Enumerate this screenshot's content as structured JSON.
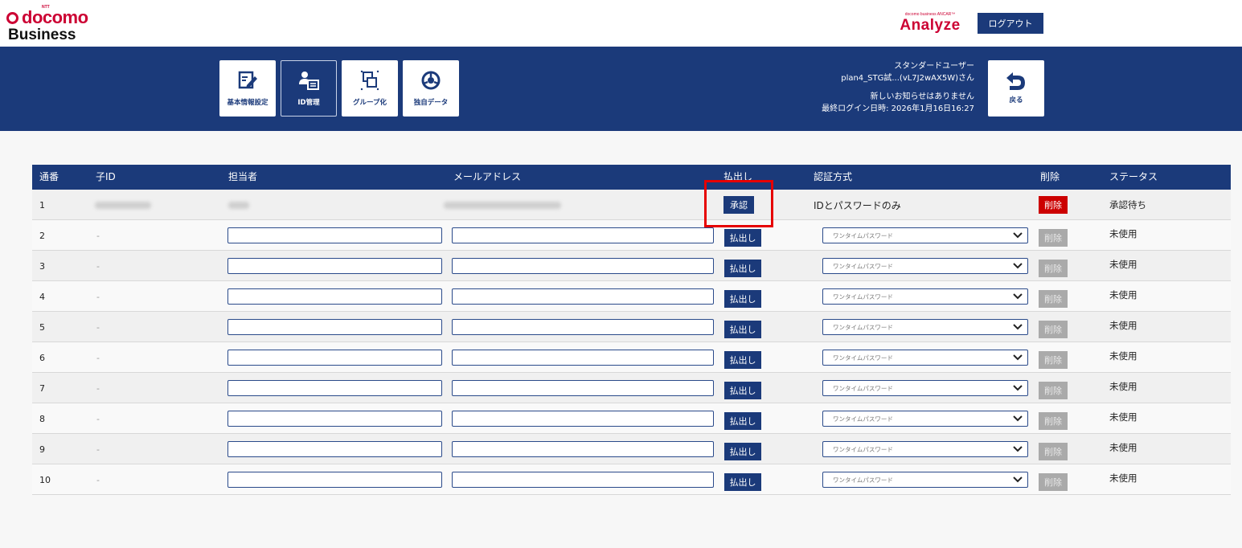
{
  "header": {
    "logo": {
      "ntt": "NTT",
      "brand": "docomo",
      "business": "Business"
    },
    "analyze": {
      "small": "docomo business ANCAR™",
      "big": "Analyze"
    },
    "logout_label": "ログアウト"
  },
  "nav": [
    {
      "label": "基本情報設定",
      "icon": "edit-icon"
    },
    {
      "label": "ID管理",
      "icon": "id-card-icon"
    },
    {
      "label": "グループ化",
      "icon": "group-icon"
    },
    {
      "label": "独自データ",
      "icon": "data-icon"
    }
  ],
  "user": {
    "role": "スタンダードユーザー",
    "name": "plan4_STG試...(vL7J2wAX5W)さん",
    "notice": "新しいお知らせはありません",
    "last_login": "最終ログイン日時: 2026年1月16日16:27"
  },
  "back_label": "戻る",
  "table": {
    "headers": {
      "no": "通番",
      "child_id": "子ID",
      "person": "担当者",
      "email": "メールアドレス",
      "issue": "払出し",
      "auth": "認証方式",
      "delete": "削除",
      "status": "ステータス"
    },
    "first_row": {
      "no": "1",
      "approve_label": "承認",
      "auth": "IDとパスワードのみ",
      "delete_label": "削除",
      "status": "承認待ち"
    },
    "rows": [
      {
        "no": "2",
        "child_id": "-",
        "issue_label": "払出し",
        "auth": "ワンタイムパスワード",
        "delete_label": "削除",
        "status": "未使用"
      },
      {
        "no": "3",
        "child_id": "-",
        "issue_label": "払出し",
        "auth": "ワンタイムパスワード",
        "delete_label": "削除",
        "status": "未使用"
      },
      {
        "no": "4",
        "child_id": "-",
        "issue_label": "払出し",
        "auth": "ワンタイムパスワード",
        "delete_label": "削除",
        "status": "未使用"
      },
      {
        "no": "5",
        "child_id": "-",
        "issue_label": "払出し",
        "auth": "ワンタイムパスワード",
        "delete_label": "削除",
        "status": "未使用"
      },
      {
        "no": "6",
        "child_id": "-",
        "issue_label": "払出し",
        "auth": "ワンタイムパスワード",
        "delete_label": "削除",
        "status": "未使用"
      },
      {
        "no": "7",
        "child_id": "-",
        "issue_label": "払出し",
        "auth": "ワンタイムパスワード",
        "delete_label": "削除",
        "status": "未使用"
      },
      {
        "no": "8",
        "child_id": "-",
        "issue_label": "払出し",
        "auth": "ワンタイムパスワード",
        "delete_label": "削除",
        "status": "未使用"
      },
      {
        "no": "9",
        "child_id": "-",
        "issue_label": "払出し",
        "auth": "ワンタイムパスワード",
        "delete_label": "削除",
        "status": "未使用"
      },
      {
        "no": "10",
        "child_id": "-",
        "issue_label": "払出し",
        "auth": "ワンタイムパスワード",
        "delete_label": "削除",
        "status": "未使用"
      }
    ]
  },
  "colors": {
    "primary": "#1b3a7a",
    "danger": "#cc0000",
    "brand": "#cc0033",
    "highlight": "#e60000"
  }
}
